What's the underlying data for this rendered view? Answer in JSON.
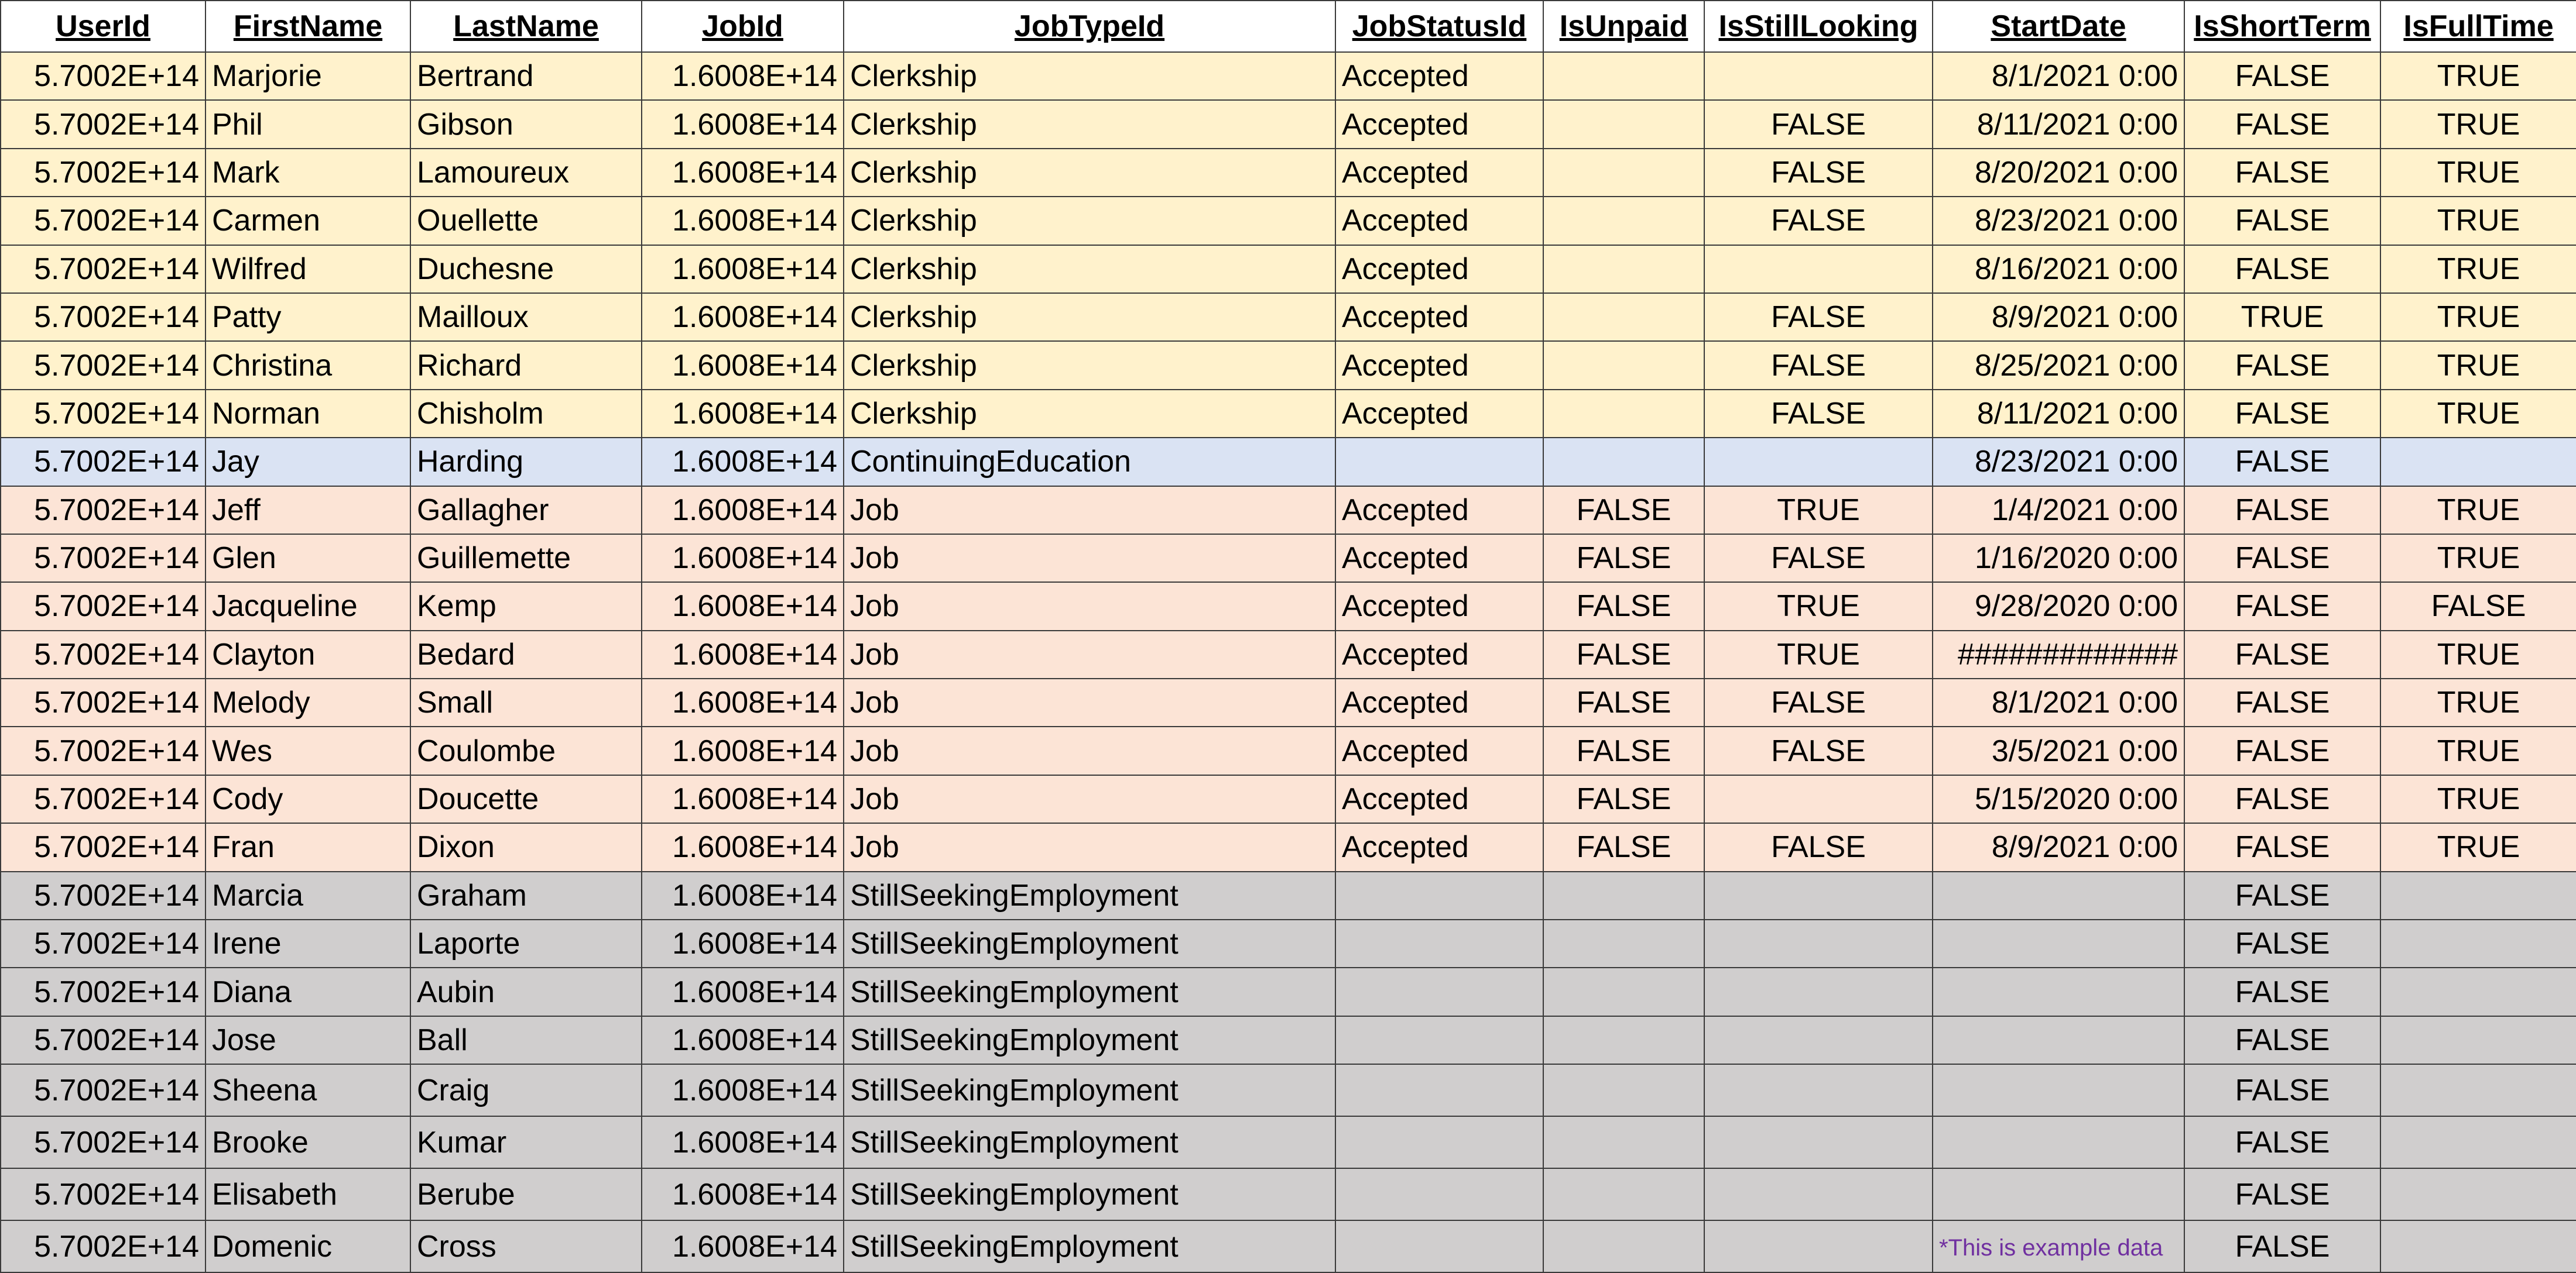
{
  "headers": [
    "UserId",
    "FirstName",
    "LastName",
    "JobId",
    "JobTypeId",
    "JobStatusId",
    "IsUnpaid",
    "IsStillLooking",
    "StartDate",
    "IsShortTerm",
    "IsFullTime"
  ],
  "colors": {
    "clerkship": "#fff2cc",
    "continuing": "#dae3f3",
    "job": "#fce4d6",
    "seeking": "#d0cece",
    "note": "#7030a0",
    "grid": "#3a3a3a"
  },
  "rows": [
    {
      "UserId": "5.7002E+14",
      "FirstName": "Marjorie",
      "LastName": "Bertrand",
      "JobId": "1.6008E+14",
      "JobTypeId": "Clerkship",
      "JobStatusId": "Accepted",
      "IsUnpaid": "",
      "IsStillLooking": "",
      "StartDate": "8/1/2021 0:00",
      "IsShortTerm": "FALSE",
      "IsFullTime": "TRUE",
      "group": "clerkship"
    },
    {
      "UserId": "5.7002E+14",
      "FirstName": "Phil",
      "LastName": "Gibson",
      "JobId": "1.6008E+14",
      "JobTypeId": "Clerkship",
      "JobStatusId": "Accepted",
      "IsUnpaid": "",
      "IsStillLooking": "FALSE",
      "StartDate": "8/11/2021 0:00",
      "IsShortTerm": "FALSE",
      "IsFullTime": "TRUE",
      "group": "clerkship"
    },
    {
      "UserId": "5.7002E+14",
      "FirstName": "Mark",
      "LastName": "Lamoureux",
      "JobId": "1.6008E+14",
      "JobTypeId": "Clerkship",
      "JobStatusId": "Accepted",
      "IsUnpaid": "",
      "IsStillLooking": "FALSE",
      "StartDate": "8/20/2021 0:00",
      "IsShortTerm": "FALSE",
      "IsFullTime": "TRUE",
      "group": "clerkship"
    },
    {
      "UserId": "5.7002E+14",
      "FirstName": "Carmen",
      "LastName": "Ouellette",
      "JobId": "1.6008E+14",
      "JobTypeId": "Clerkship",
      "JobStatusId": "Accepted",
      "IsUnpaid": "",
      "IsStillLooking": "FALSE",
      "StartDate": "8/23/2021 0:00",
      "IsShortTerm": "FALSE",
      "IsFullTime": "TRUE",
      "group": "clerkship"
    },
    {
      "UserId": "5.7002E+14",
      "FirstName": "Wilfred",
      "LastName": "Duchesne",
      "JobId": "1.6008E+14",
      "JobTypeId": "Clerkship",
      "JobStatusId": "Accepted",
      "IsUnpaid": "",
      "IsStillLooking": "",
      "StartDate": "8/16/2021 0:00",
      "IsShortTerm": "FALSE",
      "IsFullTime": "TRUE",
      "group": "clerkship"
    },
    {
      "UserId": "5.7002E+14",
      "FirstName": "Patty",
      "LastName": "Mailloux",
      "JobId": "1.6008E+14",
      "JobTypeId": "Clerkship",
      "JobStatusId": "Accepted",
      "IsUnpaid": "",
      "IsStillLooking": "FALSE",
      "StartDate": "8/9/2021 0:00",
      "IsShortTerm": "TRUE",
      "IsFullTime": "TRUE",
      "group": "clerkship"
    },
    {
      "UserId": "5.7002E+14",
      "FirstName": "Christina",
      "LastName": "Richard",
      "JobId": "1.6008E+14",
      "JobTypeId": "Clerkship",
      "JobStatusId": "Accepted",
      "IsUnpaid": "",
      "IsStillLooking": "FALSE",
      "StartDate": "8/25/2021 0:00",
      "IsShortTerm": "FALSE",
      "IsFullTime": "TRUE",
      "group": "clerkship"
    },
    {
      "UserId": "5.7002E+14",
      "FirstName": "Norman",
      "LastName": "Chisholm",
      "JobId": "1.6008E+14",
      "JobTypeId": "Clerkship",
      "JobStatusId": "Accepted",
      "IsUnpaid": "",
      "IsStillLooking": "FALSE",
      "StartDate": "8/11/2021 0:00",
      "IsShortTerm": "FALSE",
      "IsFullTime": "TRUE",
      "group": "clerkship"
    },
    {
      "UserId": "5.7002E+14",
      "FirstName": "Jay",
      "LastName": "Harding",
      "JobId": "1.6008E+14",
      "JobTypeId": "ContinuingEducation",
      "JobStatusId": "",
      "IsUnpaid": "",
      "IsStillLooking": "",
      "StartDate": "8/23/2021 0:00",
      "IsShortTerm": "FALSE",
      "IsFullTime": "",
      "group": "continuing"
    },
    {
      "UserId": "5.7002E+14",
      "FirstName": "Jeff",
      "LastName": "Gallagher",
      "JobId": "1.6008E+14",
      "JobTypeId": "Job",
      "JobStatusId": "Accepted",
      "IsUnpaid": "FALSE",
      "IsStillLooking": "TRUE",
      "StartDate": "1/4/2021 0:00",
      "IsShortTerm": "FALSE",
      "IsFullTime": "TRUE",
      "group": "job"
    },
    {
      "UserId": "5.7002E+14",
      "FirstName": "Glen",
      "LastName": "Guillemette",
      "JobId": "1.6008E+14",
      "JobTypeId": "Job",
      "JobStatusId": "Accepted",
      "IsUnpaid": "FALSE",
      "IsStillLooking": "FALSE",
      "StartDate": "1/16/2020 0:00",
      "IsShortTerm": "FALSE",
      "IsFullTime": "TRUE",
      "group": "job"
    },
    {
      "UserId": "5.7002E+14",
      "FirstName": "Jacqueline",
      "LastName": "Kemp",
      "JobId": "1.6008E+14",
      "JobTypeId": "Job",
      "JobStatusId": "Accepted",
      "IsUnpaid": "FALSE",
      "IsStillLooking": "TRUE",
      "StartDate": "9/28/2020 0:00",
      "IsShortTerm": "FALSE",
      "IsFullTime": "FALSE",
      "group": "job"
    },
    {
      "UserId": "5.7002E+14",
      "FirstName": "Clayton",
      "LastName": "Bedard",
      "JobId": "1.6008E+14",
      "JobTypeId": "Job",
      "JobStatusId": "Accepted",
      "IsUnpaid": "FALSE",
      "IsStillLooking": "TRUE",
      "StartDate": "#############",
      "IsShortTerm": "FALSE",
      "IsFullTime": "TRUE",
      "group": "job"
    },
    {
      "UserId": "5.7002E+14",
      "FirstName": "Melody",
      "LastName": "Small",
      "JobId": "1.6008E+14",
      "JobTypeId": "Job",
      "JobStatusId": "Accepted",
      "IsUnpaid": "FALSE",
      "IsStillLooking": "FALSE",
      "StartDate": "8/1/2021 0:00",
      "IsShortTerm": "FALSE",
      "IsFullTime": "TRUE",
      "group": "job"
    },
    {
      "UserId": "5.7002E+14",
      "FirstName": "Wes",
      "LastName": "Coulombe",
      "JobId": "1.6008E+14",
      "JobTypeId": "Job",
      "JobStatusId": "Accepted",
      "IsUnpaid": "FALSE",
      "IsStillLooking": "FALSE",
      "StartDate": "3/5/2021 0:00",
      "IsShortTerm": "FALSE",
      "IsFullTime": "TRUE",
      "group": "job"
    },
    {
      "UserId": "5.7002E+14",
      "FirstName": "Cody",
      "LastName": "Doucette",
      "JobId": "1.6008E+14",
      "JobTypeId": "Job",
      "JobStatusId": "Accepted",
      "IsUnpaid": "FALSE",
      "IsStillLooking": "",
      "StartDate": "5/15/2020 0:00",
      "IsShortTerm": "FALSE",
      "IsFullTime": "TRUE",
      "group": "job"
    },
    {
      "UserId": "5.7002E+14",
      "FirstName": "Fran",
      "LastName": "Dixon",
      "JobId": "1.6008E+14",
      "JobTypeId": "Job",
      "JobStatusId": "Accepted",
      "IsUnpaid": "FALSE",
      "IsStillLooking": "FALSE",
      "StartDate": "8/9/2021 0:00",
      "IsShortTerm": "FALSE",
      "IsFullTime": "TRUE",
      "group": "job"
    },
    {
      "UserId": "5.7002E+14",
      "FirstName": "Marcia",
      "LastName": "Graham",
      "JobId": "1.6008E+14",
      "JobTypeId": "StillSeekingEmployment",
      "JobStatusId": "",
      "IsUnpaid": "",
      "IsStillLooking": "",
      "StartDate": "",
      "IsShortTerm": "FALSE",
      "IsFullTime": "",
      "group": "seeking"
    },
    {
      "UserId": "5.7002E+14",
      "FirstName": "Irene",
      "LastName": "Laporte",
      "JobId": "1.6008E+14",
      "JobTypeId": "StillSeekingEmployment",
      "JobStatusId": "",
      "IsUnpaid": "",
      "IsStillLooking": "",
      "StartDate": "",
      "IsShortTerm": "FALSE",
      "IsFullTime": "",
      "group": "seeking"
    },
    {
      "UserId": "5.7002E+14",
      "FirstName": "Diana",
      "LastName": "Aubin",
      "JobId": "1.6008E+14",
      "JobTypeId": "StillSeekingEmployment",
      "JobStatusId": "",
      "IsUnpaid": "",
      "IsStillLooking": "",
      "StartDate": "",
      "IsShortTerm": "FALSE",
      "IsFullTime": "",
      "group": "seeking"
    },
    {
      "UserId": "5.7002E+14",
      "FirstName": "Jose",
      "LastName": "Ball",
      "JobId": "1.6008E+14",
      "JobTypeId": "StillSeekingEmployment",
      "JobStatusId": "",
      "IsUnpaid": "",
      "IsStillLooking": "",
      "StartDate": "",
      "IsShortTerm": "FALSE",
      "IsFullTime": "",
      "group": "seeking"
    },
    {
      "UserId": "5.7002E+14",
      "FirstName": "Sheena",
      "LastName": "Craig",
      "JobId": "1.6008E+14",
      "JobTypeId": "StillSeekingEmployment",
      "JobStatusId": "",
      "IsUnpaid": "",
      "IsStillLooking": "",
      "StartDate": "",
      "IsShortTerm": "FALSE",
      "IsFullTime": "",
      "group": "seeking"
    },
    {
      "UserId": "5.7002E+14",
      "FirstName": "Brooke",
      "LastName": "Kumar",
      "JobId": "1.6008E+14",
      "JobTypeId": "StillSeekingEmployment",
      "JobStatusId": "",
      "IsUnpaid": "",
      "IsStillLooking": "",
      "StartDate": "",
      "IsShortTerm": "FALSE",
      "IsFullTime": "",
      "group": "seeking"
    },
    {
      "UserId": "5.7002E+14",
      "FirstName": "Elisabeth",
      "LastName": "Berube",
      "JobId": "1.6008E+14",
      "JobTypeId": "StillSeekingEmployment",
      "JobStatusId": "",
      "IsUnpaid": "",
      "IsStillLooking": "",
      "StartDate": "",
      "IsShortTerm": "FALSE",
      "IsFullTime": "",
      "group": "seeking"
    },
    {
      "UserId": "5.7002E+14",
      "FirstName": "Domenic",
      "LastName": "Cross",
      "JobId": "1.6008E+14",
      "JobTypeId": "StillSeekingEmployment",
      "JobStatusId": "",
      "IsUnpaid": "",
      "IsStillLooking": "",
      "StartDate": "",
      "IsShortTerm": "FALSE",
      "IsFullTime": "",
      "group": "seeking"
    }
  ],
  "note": "*This is example data"
}
